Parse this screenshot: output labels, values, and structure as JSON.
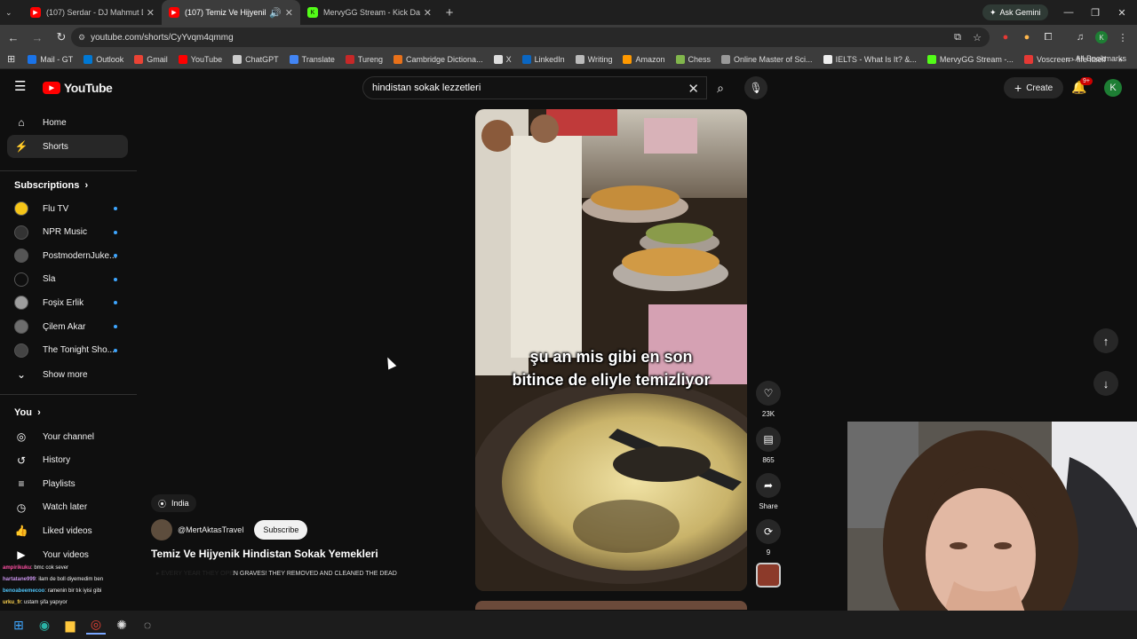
{
  "browser": {
    "tabs": [
      {
        "label": "(107) Serdar - DJ Mahmut Deg",
        "icon_color": "#ff0000"
      },
      {
        "label": "(107) Temiz Ve Hijyenik Hin",
        "icon_color": "#ff0000"
      },
      {
        "label": "MervyGG Stream - Kick Dashbo",
        "icon_color": "#53fc18"
      }
    ],
    "new_tab": "+",
    "ask_gemini": "Ask Gemini",
    "url": "youtube.com/shorts/CyYvqm4qmmg",
    "bookmarks": [
      {
        "label": "Mail - GT",
        "color": "#1a73e8"
      },
      {
        "label": "Outlook",
        "color": "#0078d4"
      },
      {
        "label": "Gmail",
        "color": "#ea4335"
      },
      {
        "label": "YouTube",
        "color": "#ff0000"
      },
      {
        "label": "ChatGPT",
        "color": "#cccccc"
      },
      {
        "label": "Translate",
        "color": "#4285f4"
      },
      {
        "label": "Tureng",
        "color": "#c62828"
      },
      {
        "label": "Cambridge Dictiona...",
        "color": "#e8711a"
      },
      {
        "label": "X",
        "color": "#dddddd"
      },
      {
        "label": "LinkedIn",
        "color": "#0a66c2"
      },
      {
        "label": "Writing",
        "color": "#bbbbbb"
      },
      {
        "label": "Amazon",
        "color": "#ff9900"
      },
      {
        "label": "Chess",
        "color": "#81b64c"
      },
      {
        "label": "Online Master of Sci...",
        "color": "#999999"
      },
      {
        "label": "IELTS - What Is It? &...",
        "color": "#eeeeee"
      },
      {
        "label": "MervyGG Stream -...",
        "color": "#53fc18"
      },
      {
        "label": "Voscreen - life itself",
        "color": "#e53935"
      }
    ],
    "all_bookmarks": "All Bookmarks"
  },
  "youtube": {
    "logo": "YouTube",
    "search_value": "hindistan sokak lezzetleri",
    "create": "Create",
    "notif_count": "9+",
    "avatar_letter": "K"
  },
  "sidebar": {
    "main": [
      {
        "label": "Home",
        "icon": "⌂"
      },
      {
        "label": "Shorts",
        "icon": "⚡"
      }
    ],
    "subscriptions_title": "Subscriptions",
    "subscriptions": [
      {
        "label": "Flu TV",
        "color": "#f5c518"
      },
      {
        "label": "NPR Music",
        "color": "#333333"
      },
      {
        "label": "PostmodernJuke...",
        "color": "#555555"
      },
      {
        "label": "Sla",
        "color": "#0f0f0f"
      },
      {
        "label": "Foşix Erlik",
        "color": "#9e9e9e"
      },
      {
        "label": "Çilem Akar",
        "color": "#6d6d6d"
      },
      {
        "label": "The Tonight Sho...",
        "color": "#444444"
      }
    ],
    "show_more": "Show more",
    "you_title": "You",
    "you": [
      {
        "label": "Your channel",
        "icon": "◎"
      },
      {
        "label": "History",
        "icon": "↺"
      },
      {
        "label": "Playlists",
        "icon": "≡"
      },
      {
        "label": "Watch later",
        "icon": "◷"
      },
      {
        "label": "Liked videos",
        "icon": "👍"
      },
      {
        "label": "Your videos",
        "icon": "▶"
      }
    ]
  },
  "short": {
    "caption_line1": "şu an mis gibi en son",
    "caption_line2": "bitince de eliyle temizliyor",
    "likes": "23K",
    "comments": "865",
    "share": "Share",
    "remix": "9",
    "location": "India",
    "channel": "@MertAktasTravel",
    "subscribe": "Subscribe",
    "title": "Temiz Ve Hijyenik Hindistan Sokak Yemekleri",
    "music": "EVERY YEAR THEY OPEN GRAVES! THEY REMOVED AND CLEANED THE DEAD"
  },
  "chat": [
    {
      "user": "ampirikuku",
      "msg": ": bmc cok sever",
      "color": "#ff4fa3"
    },
    {
      "user": "hartatane999",
      "msg": ": ilam de boll diyemedim ben",
      "color": "#c792ea"
    },
    {
      "user": "benoabeemecoo",
      "msg": ": ramenin bir tık iyisi gibi",
      "color": "#4fc3f7"
    },
    {
      "user": "urku_fr",
      "msg": ": ustam şifa yapıyor",
      "color": "#ffd54f"
    }
  ]
}
